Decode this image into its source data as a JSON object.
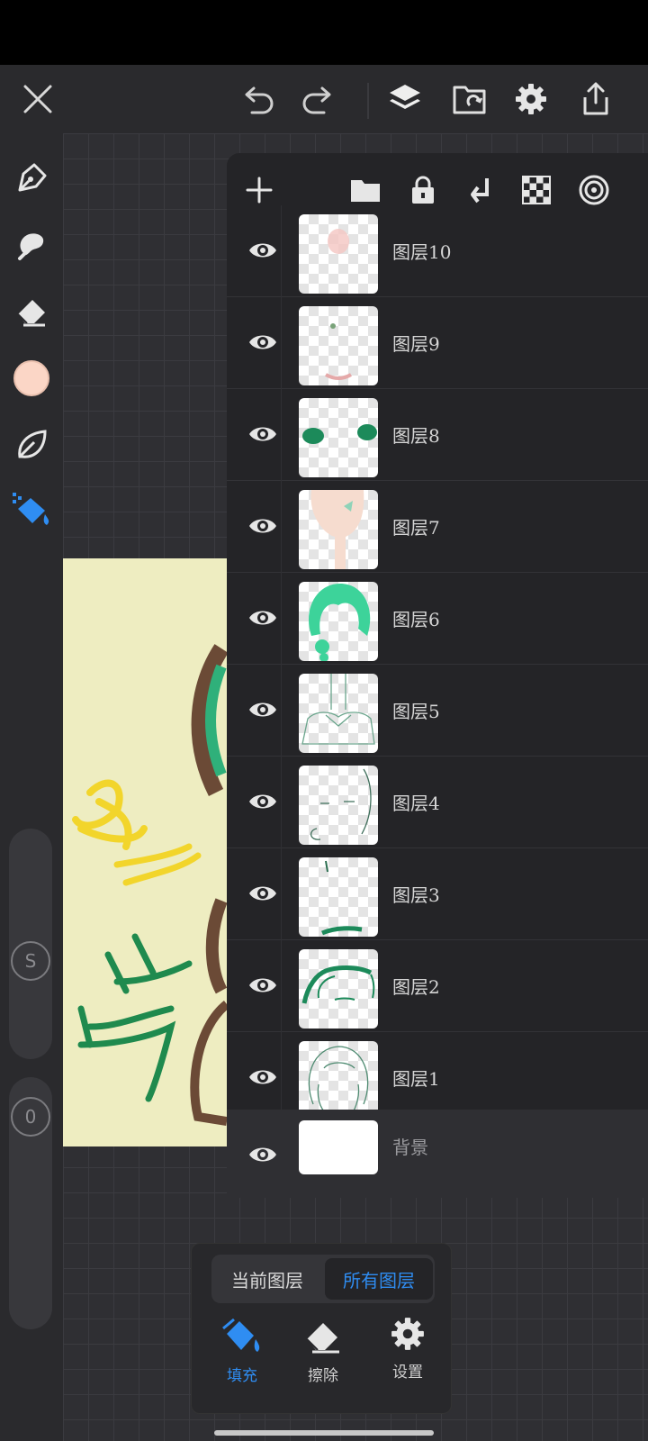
{
  "layers_panel": {
    "layers": [
      {
        "name": "图层10"
      },
      {
        "name": "图层9"
      },
      {
        "name": "图层8"
      },
      {
        "name": "图层7"
      },
      {
        "name": "图层6"
      },
      {
        "name": "图层5"
      },
      {
        "name": "图层4"
      },
      {
        "name": "图层3"
      },
      {
        "name": "图层2"
      },
      {
        "name": "图层1"
      },
      {
        "name": "背景"
      }
    ]
  },
  "left_toolbar": {
    "slider_size_label": "S",
    "slider_opacity_value": "0",
    "current_color": "#fbd6c6"
  },
  "fill_panel": {
    "scope_current": "当前图层",
    "scope_all": "所有图层",
    "fill_label": "填充",
    "erase_label": "擦除",
    "settings_label": "设置"
  },
  "colors": {
    "accent": "#2f8df2",
    "panel": "#242427",
    "canvas_paper": "#eeedc1"
  }
}
